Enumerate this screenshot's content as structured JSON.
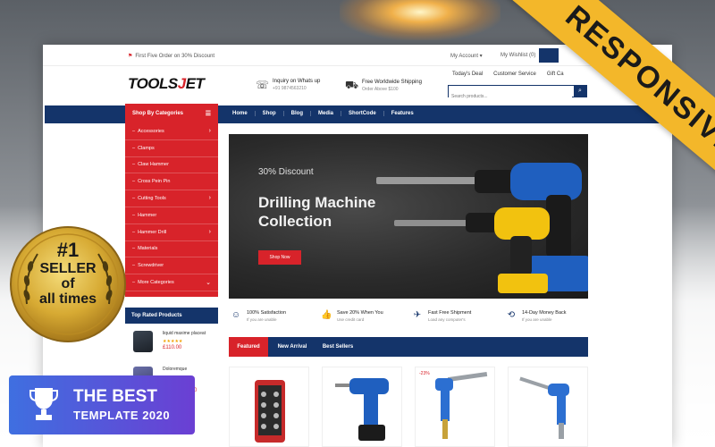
{
  "site": {
    "topbar": {
      "promo": "First Five Order on 30% Discount",
      "account": "My Account",
      "wishlist": "My Wishlist (0)"
    },
    "logo": {
      "pre": "TOOLS",
      "acc": "J",
      "post": "ET"
    },
    "info": [
      {
        "title": "Inquiry on Whats up",
        "sub": "+91 9874563210",
        "icon": "headset-icon"
      },
      {
        "title": "Free Worldwide Shipping",
        "sub": "Order Above $100",
        "icon": "truck-icon"
      }
    ],
    "links": [
      "Today's Deal",
      "Customer Service",
      "Gift Ca"
    ],
    "search": {
      "placeholder": "Search products..."
    },
    "nav": {
      "category_title": "Shop By Categories",
      "items": [
        "Home",
        "Shop",
        "Blog",
        "Media",
        "ShortCode",
        "Features"
      ]
    },
    "categories": [
      "Accessories",
      "Clamps",
      "Claw Hammer",
      "Cross Pein Pin",
      "Cutting Tools",
      "Hammer",
      "Hammer Drill",
      "Materials",
      "Screwdriver",
      "More Categories"
    ],
    "top_rated": {
      "title": "Top Rated Products",
      "items": [
        {
          "name": "liquid maxime placeat",
          "stars": "★★★★★",
          "price": "£110.00"
        },
        {
          "name": "Doloremque",
          "stars": "",
          "price": ".00"
        }
      ]
    },
    "hero": {
      "discount": "30% Discount",
      "title": "Drilling Machine Collection",
      "button": "Shop Now"
    },
    "features": [
      {
        "title": "100% Satisfaction",
        "sub": "If you are unable",
        "icon": "smile-icon"
      },
      {
        "title": "Save 20% When You",
        "sub": "Use credit card",
        "icon": "thumbs-up-icon"
      },
      {
        "title": "Fast Free Shipment",
        "sub": "Load any computer's",
        "icon": "plane-icon"
      },
      {
        "title": "14-Day Money Back",
        "sub": "If you are unable",
        "icon": "refresh-icon"
      }
    ],
    "tabs": [
      "Featured",
      "New Arrival",
      "Best Sellers"
    ],
    "sale_label": "-23%"
  },
  "ribbon": "RESPONSIVE",
  "badge": {
    "rank": "#1",
    "line2": "SELLER",
    "line3": "of",
    "line4": "all times"
  },
  "best": {
    "line1": "THE BEST",
    "line2": "TEMPLATE 2020"
  },
  "colors": {
    "navy": "#14346a",
    "red": "#d8232a",
    "gold": "#f3b72a",
    "purple": "#6b3fd3"
  }
}
